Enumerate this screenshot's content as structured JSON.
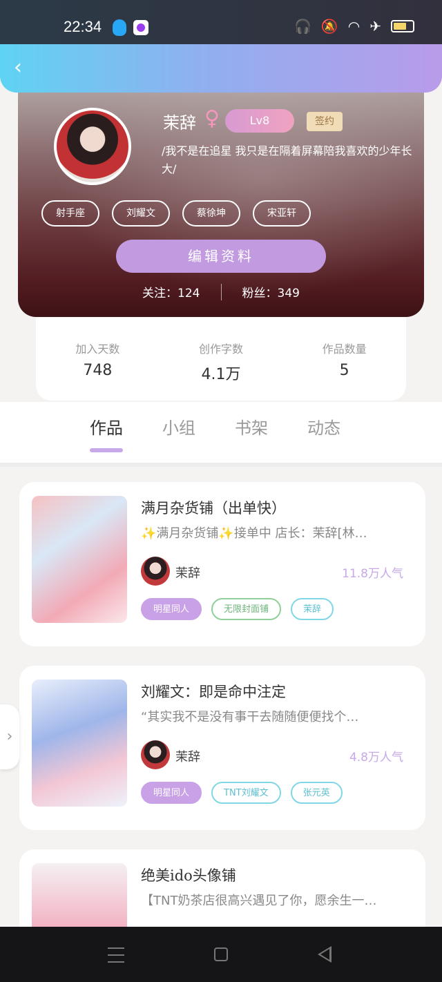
{
  "status_bar": {
    "time": "22:34"
  },
  "profile": {
    "username": "茉辞",
    "gender_symbol": "♀",
    "level": "Lv8",
    "signed_label": "签约",
    "bio": "/我不是在追星 我只是在隔着屏幕陪我喜欢的少年长大/",
    "tags": [
      "射手座",
      "刘耀文",
      "蔡徐坤",
      "宋亚轩"
    ],
    "edit_label": "编辑资料",
    "following": "关注：124",
    "followers": "粉丝：349"
  },
  "stats": [
    {
      "label": "加入天数",
      "value": "748"
    },
    {
      "label": "创作字数",
      "value": "4.1万"
    },
    {
      "label": "作品数量",
      "value": "5"
    }
  ],
  "tabs": [
    {
      "label": "作品",
      "active": true
    },
    {
      "label": "小组",
      "active": false
    },
    {
      "label": "书架",
      "active": false
    },
    {
      "label": "动态",
      "active": false
    }
  ],
  "works": [
    {
      "title": "满月杂货铺（出单快）",
      "desc": "✨满月杂货铺✨接单中 店长：茉辞[林…",
      "author": "茉辞",
      "popularity": "11.8万人气",
      "tags": [
        "明星同人",
        "无限封面铺",
        "茉辞"
      ]
    },
    {
      "title": "刘耀文：即是命中注定",
      "desc": "“其实我不是没有事干去随随便便找个…",
      "author": "茉辞",
      "popularity": "4.8万人气",
      "tags": [
        "明星同人",
        "TNT刘耀文",
        "张元英"
      ]
    },
    {
      "title": "绝美ido头像铺",
      "desc": "【TNT奶茶店很高兴遇见了你，愿余生一…",
      "author": "",
      "popularity": "",
      "tags": []
    }
  ],
  "colors": {
    "accent": "#c7a8e8",
    "header_start": "#5fd3f3",
    "header_end": "#b89be9"
  },
  "icons": {
    "back": "chevron-left-icon",
    "side": "chevron-right-icon"
  }
}
